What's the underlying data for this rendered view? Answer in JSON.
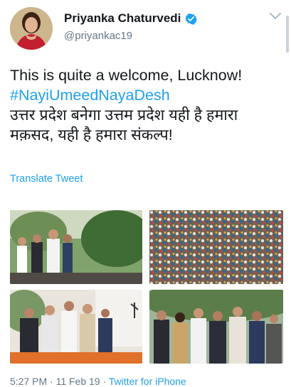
{
  "author": {
    "name": "Priyanka Chaturvedi",
    "handle": "@priyankac19",
    "verified_icon": "verified-badge-icon",
    "colors": {
      "verified": "#1da1f2"
    }
  },
  "tweet": {
    "line1": "This is quite a welcome, Lucknow!",
    "hashtag": "#NayiUmeedNayaDesh",
    "line3": "उत्तर प्रदेश बनेगा उत्तम प्रदेश यही है हमारा",
    "line4": "मक़सद, यही है हमारा संकल्प!"
  },
  "translate_label": "Translate Tweet",
  "media": {
    "photo_count": 4
  },
  "footer": {
    "timestamp": "5:27 PM · 11 Feb 19 · ",
    "via": "Twitter for iPhone"
  },
  "colors": {
    "link": "#1da1f2",
    "secondary_text": "#657786",
    "text": "#14171a"
  }
}
